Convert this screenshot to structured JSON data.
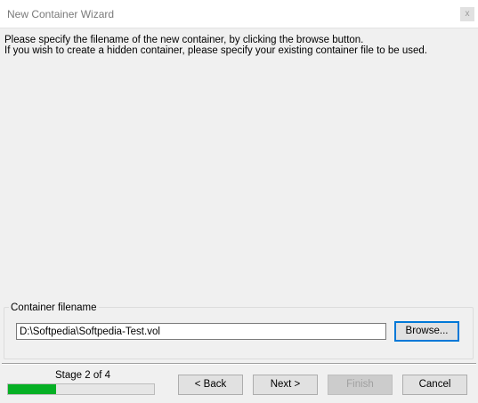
{
  "window": {
    "title": "New Container Wizard",
    "close_glyph": "x"
  },
  "instructions": {
    "line1": "Please specify the filename of the new container, by clicking the browse button.",
    "line2": "If you wish to create a hidden container, please specify your existing container file to be used."
  },
  "container": {
    "group_label": "Container filename",
    "filename_value": "D:\\Softpedia\\Softpedia-Test.vol",
    "browse_label": "Browse..."
  },
  "footer": {
    "stage_label": "Stage 2 of 4",
    "progress_fraction": 0.33,
    "back_label": "< Back",
    "next_label": "Next >",
    "finish_label": "Finish",
    "cancel_label": "Cancel"
  },
  "colors": {
    "progress_fill": "#06b025",
    "focus_border": "#0078d7"
  }
}
